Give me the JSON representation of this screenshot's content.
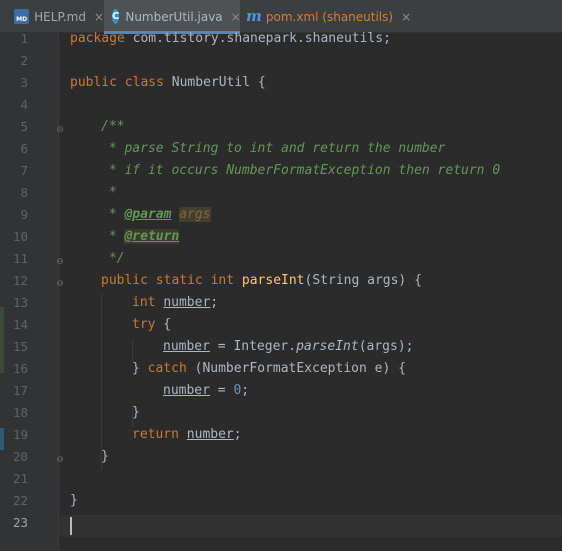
{
  "tabs": [
    {
      "label": "HELP.md",
      "icon": "markdown-file-icon",
      "active": false,
      "close": "×"
    },
    {
      "label": "NumberUtil.java",
      "icon": "java-class-icon",
      "active": true,
      "close": "×"
    },
    {
      "label": "pom.xml (shaneutils)",
      "icon": "maven-icon",
      "active": false,
      "close": "×"
    }
  ],
  "icons": {
    "md_text": "MD",
    "class_letter": "C",
    "maven_letter": "m"
  },
  "editor": {
    "line_numbers": [
      "1",
      "2",
      "3",
      "4",
      "5",
      "6",
      "7",
      "8",
      "9",
      "10",
      "11",
      "12",
      "13",
      "14",
      "15",
      "16",
      "17",
      "18",
      "19",
      "20",
      "21",
      "22",
      "23"
    ],
    "current_line": 23,
    "code": {
      "l1_kw": "package",
      "l1_rest": " com.tistory.shanepark.shaneutils;",
      "l3_kw1": "public",
      "l3_kw2": "class",
      "l3_rest": " NumberUtil {",
      "l5": "/**",
      "l6": " * parse String to int and return the number",
      "l7": " * if it occurs NumberFormatException then return 0",
      "l8": " *",
      "l9_prefix": " * ",
      "l9_tag": "@param",
      "l9_name": "args",
      "l10_prefix": " * ",
      "l10_tag": "@return",
      "l11": " */",
      "l12_kw": "public static int",
      "l12_fn": "parseInt",
      "l12_rest": "(String args) {",
      "l13_kw": "int",
      "l13_var": "number",
      "l13_rest": ";",
      "l14_kw": "try",
      "l14_rest": " {",
      "l15_var": "number",
      "l15_mid": " = Integer.",
      "l15_call": "parseInt",
      "l15_rest": "(args);",
      "l16_a": "} ",
      "l16_kw": "catch",
      "l16_rest": " (NumberFormatException e) {",
      "l17_var": "number",
      "l17_mid": " = ",
      "l17_num": "0",
      "l17_rest": ";",
      "l18": "}",
      "l19_kw": "return",
      "l19_var": "number",
      "l19_rest": ";",
      "l20": "}",
      "l22": "}"
    }
  },
  "colors": {
    "editor_bg": "#2b2b2b",
    "keyword": "#cc7832",
    "doc_comment": "#629755",
    "function": "#ffc66d",
    "number": "#6897bb",
    "text": "#a9b7c6"
  }
}
